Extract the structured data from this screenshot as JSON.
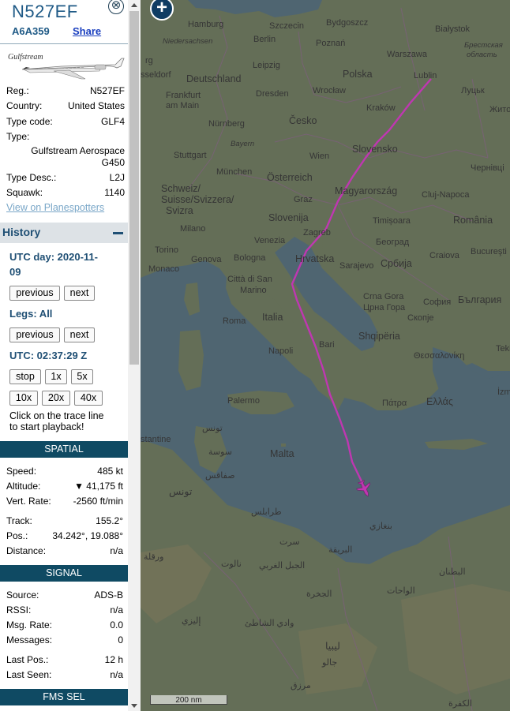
{
  "aircraft": {
    "callsign": "N527EF",
    "hex": "A6A359",
    "share_label": "Share",
    "photo_brand": "Gulfstream",
    "close_glyph": "⊗",
    "details": [
      {
        "key": "Reg.:",
        "value": "N527EF"
      },
      {
        "key": "Country:",
        "value": "United States"
      },
      {
        "key": "Type code:",
        "value": "GLF4"
      },
      {
        "key": "Type:",
        "value": ""
      },
      {
        "key": "",
        "value": "Gulfstream Aerospace"
      },
      {
        "key": "",
        "value": "G450"
      },
      {
        "key": "Type Desc.:",
        "value": "L2J"
      },
      {
        "key": "Squawk:",
        "value": "1140"
      }
    ],
    "planespotters_link": "View on Planespotters"
  },
  "history": {
    "title": "History",
    "utc_day_label": "UTC day: 2020-11-",
    "utc_day_cont": "09",
    "legs_label": "Legs: All",
    "utc_time_label": "UTC: 02:37:29 Z",
    "buttons": {
      "previous": "previous",
      "next": "next",
      "stop": "stop",
      "x1": "1x",
      "x5": "5x",
      "x10": "10x",
      "x20": "20x",
      "x40": "40x"
    },
    "hint_line1": "Click on the trace line",
    "hint_line2": "to start playback!"
  },
  "spatial": {
    "title": "SPATIAL",
    "rows": [
      {
        "key": "Speed:",
        "value": "485 kt"
      },
      {
        "key": "Altitude:",
        "value": "▼ 41,175 ft"
      },
      {
        "key": "Vert. Rate:",
        "value": "-2560 ft/min"
      },
      {
        "key": "Track:",
        "value": "155.2°"
      },
      {
        "key": "Pos.:",
        "value": "34.242°, 19.088°"
      },
      {
        "key": "Distance:",
        "value": "n/a"
      }
    ]
  },
  "signal": {
    "title": "SIGNAL",
    "rows": [
      {
        "key": "Source:",
        "value": "ADS-B"
      },
      {
        "key": "RSSI:",
        "value": "n/a"
      },
      {
        "key": "Msg. Rate:",
        "value": "0.0"
      },
      {
        "key": "Messages:",
        "value": "0"
      },
      {
        "key": "Last Pos.:",
        "value": "12 h"
      },
      {
        "key": "Last Seen:",
        "value": "n/a"
      }
    ]
  },
  "fms": {
    "title": "FMS SEL"
  },
  "map": {
    "zoom_in_label": "+",
    "scale_label": "200 nm",
    "colors": {
      "land": "#6f7a60",
      "sea": "#57707e",
      "track": "#d63cc7",
      "plane": "#d63cc7"
    },
    "labels": {
      "hamburg": "Hamburg",
      "szczecin": "Szczecin",
      "bydgoszcz": "Bydgoszcz",
      "bialystok": "Białystok",
      "niedersachsen": "Niedersachsen",
      "berlin": "Berlin",
      "poznan": "Poznań",
      "warszawa": "Warszawa",
      "brest": "Брестская",
      "oblast": "область",
      "dusseldorf": "sseldorf",
      "deutschland": "Deutschland",
      "magdeburg": "rg",
      "leipzig": "Leipzig",
      "wroclaw": "Wrocław",
      "polska": "Polska",
      "lublin": "Lublin",
      "lutsk": "Луцьк",
      "frankfurt": "Frankfurt",
      "amMain": "am Main",
      "dresden": "Dresden",
      "krakow": "Kraków",
      "zhytomyr": "Жито",
      "cesko": "Česko",
      "nurnberg": "Nürnberg",
      "bayern": "Bayern",
      "stuttgart": "Stuttgart",
      "slovensko": "Slovensko",
      "chernivtsi": "Чернівці",
      "munchen": "München",
      "wien": "Wien",
      "osterreich": "Österreich",
      "schweiz": "Schweiz/",
      "suisse": "Suisse/Svizzera/",
      "svizra": "Svizra",
      "graz": "Graz",
      "magyar": "Magyarország",
      "cluj": "Cluj-Napoca",
      "milano": "Milano",
      "slovenija": "Slovenija",
      "timisoara": "Timișoara",
      "romania": "România",
      "venezia": "Venezia",
      "zagreb": "Zagreb",
      "beograd": "Београд",
      "torino": "Torino",
      "genova": "Genova",
      "bologna": "Bologna",
      "hrvatska": "Hrvatska",
      "srbija": "Србија",
      "craiova": "Craiova",
      "bucuresti": "Bucureşti",
      "monaco": "Monaco",
      "citta": "Città di San",
      "marino": "Marino",
      "sarajevo": "Sarajevo",
      "crnagora": "Crna Gora",
      "crnagora2": "Црна Гора",
      "sofia": "София",
      "bulgaria": "България",
      "roma": "Roma",
      "italia": "Italia",
      "skopje": "Скопје",
      "napoli": "Napoli",
      "bari": "Bari",
      "shqiperia": "Shqipëria",
      "thessaloniki": "Θεσσαλονίκη",
      "teke": "Teki",
      "izm": "İzm",
      "palermo": "Palermo",
      "patra": "Πάτρα",
      "ellas": "Ελλάς",
      "constantine": "stantine",
      "tunis": "تونس",
      "sousse": "سوسة",
      "sfax": "صفاقس",
      "tunisia": "تونس",
      "malta": "Malta",
      "tripoli": "طرابلس",
      "benghazi": "بنغازي",
      "brega": "البريقة",
      "ouargla": "ورقلة",
      "nalut": "نالوت",
      "jabal": "الجبل الغربي",
      "sirte": "سرت",
      "waha": "الواحات",
      "jikharra": "الجخرة",
      "batnan": "البطنان",
      "ilizi": "إليزي",
      "shati": "وادي الشاطئ",
      "libya": "ليبيا",
      "murzuq": "مرزق",
      "jalo": "جالو",
      "kufra": "الكفرة"
    }
  }
}
